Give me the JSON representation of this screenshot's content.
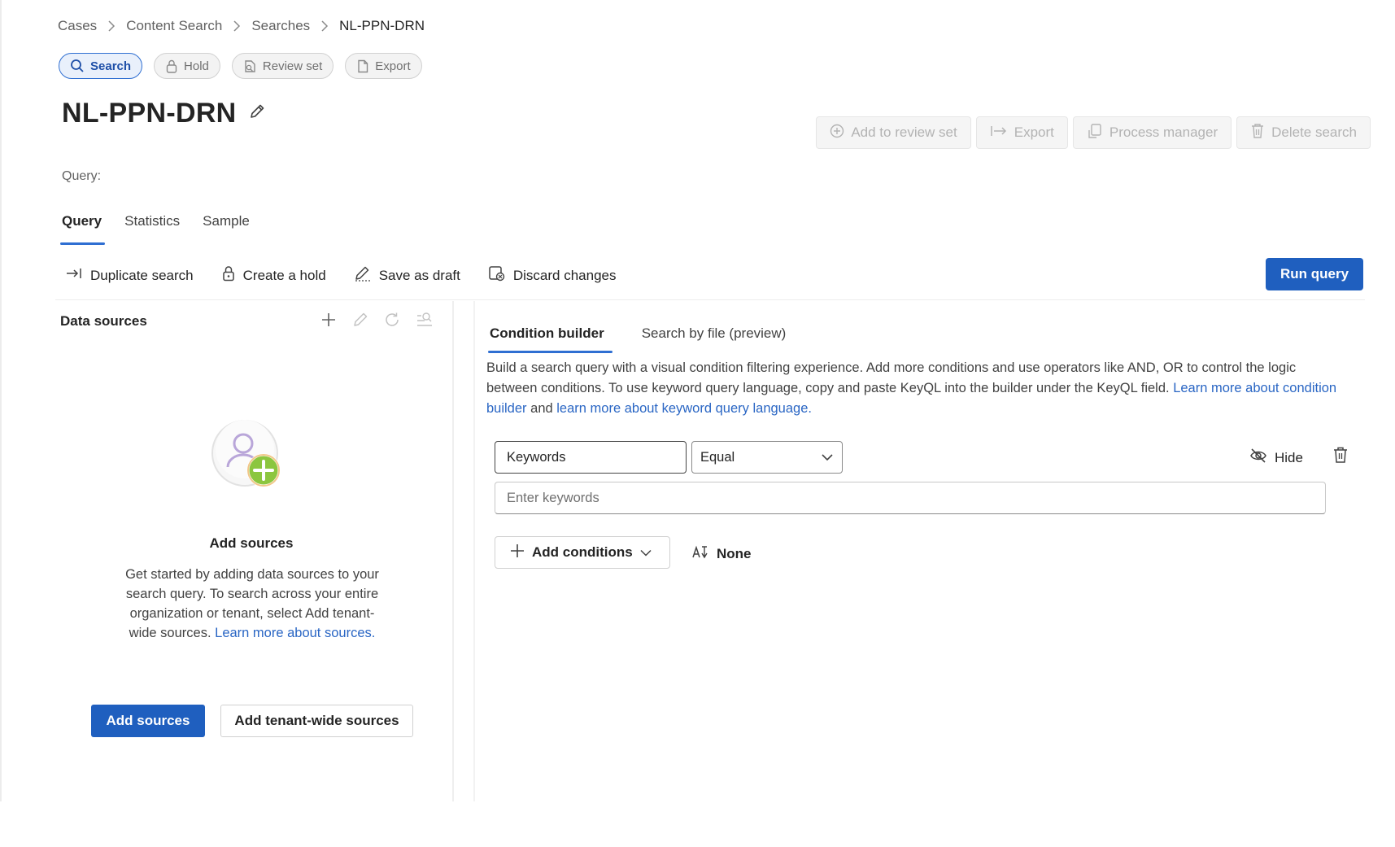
{
  "breadcrumb": [
    "Cases",
    "Content Search",
    "Searches",
    "NL-PPN-DRN"
  ],
  "pills": [
    {
      "label": "Search",
      "icon": "search-icon",
      "active": true
    },
    {
      "label": "Hold",
      "icon": "lock-icon",
      "active": false
    },
    {
      "label": "Review set",
      "icon": "review-set-icon",
      "active": false
    },
    {
      "label": "Export",
      "icon": "document-icon",
      "active": false
    }
  ],
  "title": "NL-PPN-DRN",
  "top_actions": {
    "add_to_review_set": "Add to review set",
    "export": "Export",
    "process_manager": "Process manager",
    "delete_search": "Delete search"
  },
  "query_label": "Query:",
  "query_tabs": [
    "Query",
    "Statistics",
    "Sample"
  ],
  "commands": {
    "duplicate": "Duplicate search",
    "create_hold": "Create a hold",
    "save_draft": "Save as draft",
    "discard": "Discard changes",
    "run_query": "Run query"
  },
  "data_sources": {
    "title": "Data sources",
    "empty_title": "Add sources",
    "empty_desc": "Get started by adding data sources to your search query. To search across your entire organization or tenant, select Add tenant-wide sources.",
    "learn_more": "Learn more about sources.",
    "add_sources": "Add sources",
    "add_tenant_wide": "Add tenant-wide sources"
  },
  "builder": {
    "tabs": [
      "Condition builder",
      "Search by file (preview)"
    ],
    "desc": "Build a search query with a visual condition filtering experience. Add more conditions and use operators like AND, OR to control the logic between conditions. To use keyword query language, copy and paste KeyQL into the builder under the KeyQL field.",
    "link1": "Learn more about condition builder",
    "and": "and",
    "link2": "learn more about keyword query language.",
    "field": "Keywords",
    "operator": "Equal",
    "hide": "Hide",
    "keywords_placeholder": "Enter keywords",
    "add_conditions": "Add conditions",
    "none": "None"
  },
  "colors": {
    "accent": "#1f5fbf",
    "link": "#2a66c4"
  }
}
